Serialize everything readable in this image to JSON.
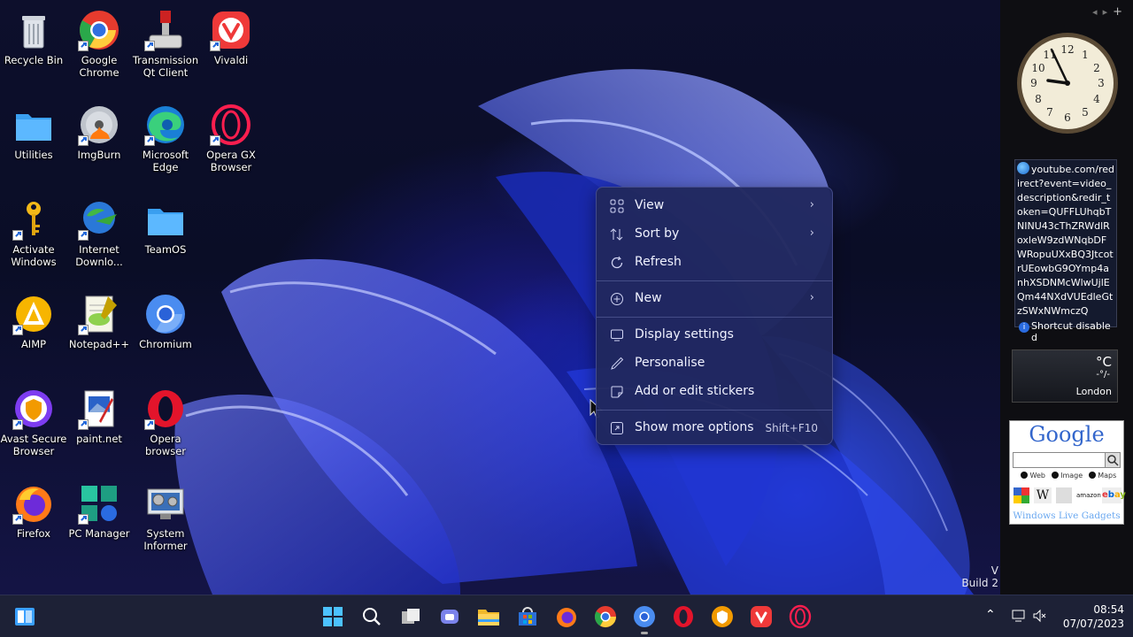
{
  "desktop": {
    "icons": [
      {
        "label": "Recycle Bin"
      },
      {
        "label": "Google\nChrome"
      },
      {
        "label": "Transmission\nQt Client"
      },
      {
        "label": "Vivaldi"
      },
      {
        "label": "Utilities"
      },
      {
        "label": "ImgBurn"
      },
      {
        "label": "Microsoft\nEdge"
      },
      {
        "label": "Opera GX\nBrowser"
      },
      {
        "label": "Activate\nWindows"
      },
      {
        "label": "Internet\nDownlo..."
      },
      {
        "label": "TeamOS"
      },
      {
        "label": "AIMP"
      },
      {
        "label": "Notepad++"
      },
      {
        "label": "Chromium"
      },
      {
        "label": "Avast Secure\nBrowser"
      },
      {
        "label": "paint.net"
      },
      {
        "label": "Opera\nbrowser"
      },
      {
        "label": "Firefox"
      },
      {
        "label": "PC Manager"
      },
      {
        "label": "System\nInformer"
      }
    ],
    "watermark": {
      "line1": "V",
      "line2": "Build 2"
    }
  },
  "context_menu": {
    "items": [
      {
        "label": "View",
        "icon": "grid-icon",
        "submenu": true
      },
      {
        "label": "Sort by",
        "icon": "sort-icon",
        "submenu": true
      },
      {
        "label": "Refresh",
        "icon": "refresh-icon",
        "submenu": false
      },
      {
        "label": "New",
        "icon": "plus-circle-icon",
        "submenu": true
      },
      {
        "label": "Display settings",
        "icon": "display-icon",
        "submenu": false
      },
      {
        "label": "Personalise",
        "icon": "pen-icon",
        "submenu": false
      },
      {
        "label": "Add or edit stickers",
        "icon": "sticker-icon",
        "submenu": false
      },
      {
        "label": "Show more options",
        "icon": "expand-icon",
        "submenu": false,
        "shortcut": "Shift+F10"
      }
    ]
  },
  "gadgets": {
    "url_text": "youtube.com/redirect?event=video_description&redir_token=QUFFLUhqbTNINU43cThZRWdlRoxleW9zdWNqbDFWRopuUXxBQ3JtcotrUEowbG9OYmp4anhXSDNMcWlwUjlEQm44NXdVUEdleGtzSWxNWmczQ",
    "shortcut_status": "Shortcut disabled",
    "weather": {
      "unit": "°C",
      "value": "-°/-",
      "city": "London"
    },
    "google": {
      "logo": "Google",
      "radio_options": [
        "Web",
        "Image",
        "Maps"
      ],
      "footer": "Windows Live Gadgets"
    }
  },
  "taskbar": {
    "apps": [
      "Start",
      "Search",
      "Task View",
      "Teams",
      "File Explorer",
      "Microsoft Store",
      "Firefox",
      "Google Chrome",
      "Chromium",
      "Opera",
      "Avast Secure Browser",
      "Vivaldi",
      "Opera GX"
    ],
    "time": "08:54",
    "date": "07/07/2023"
  }
}
